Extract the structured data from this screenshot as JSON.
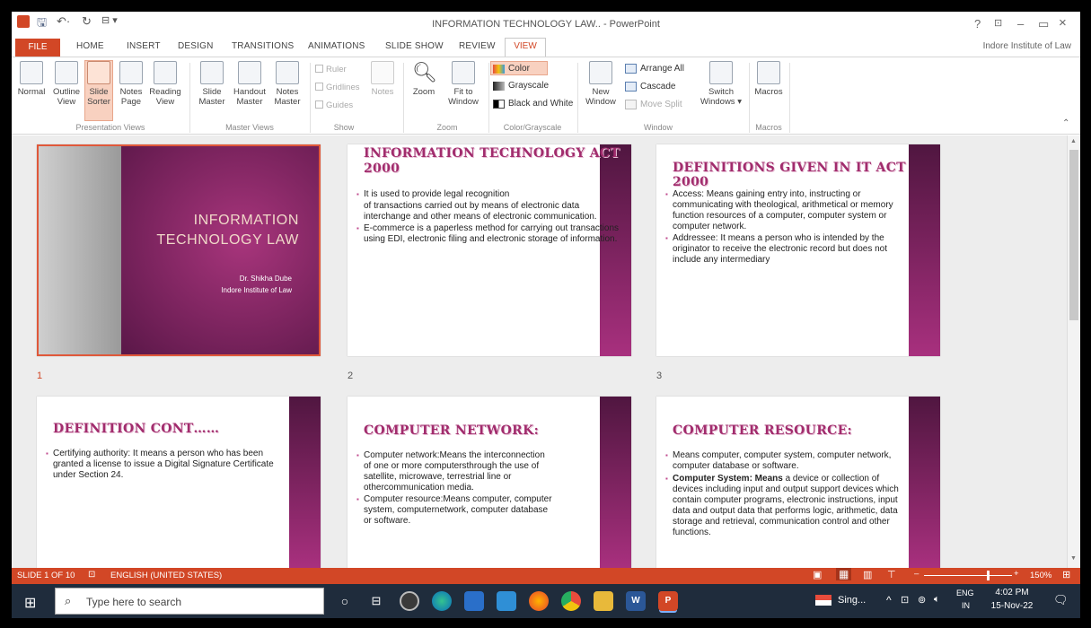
{
  "window": {
    "title": "INFORMATION TECHNOLOGY LAW.. - PowerPoint",
    "account": "Indore Institute of Law",
    "help": "?",
    "minimize": "–",
    "restore": "▭",
    "close": "×"
  },
  "tabs": {
    "file": "FILE",
    "home": "HOME",
    "insert": "INSERT",
    "design": "DESIGN",
    "transitions": "TRANSITIONS",
    "animations": "ANIMATIONS",
    "slideshow": "SLIDE SHOW",
    "review": "REVIEW",
    "view": "VIEW"
  },
  "ribbon": {
    "normal": "Normal",
    "outline": "Outline\nView",
    "slide_sorter": "Slide\nSorter",
    "notes_page": "Notes\nPage",
    "reading_view": "Reading\nView",
    "slide_master": "Slide\nMaster",
    "handout_master": "Handout\nMaster",
    "notes_master": "Notes\nMaster",
    "ruler": "Ruler",
    "gridlines": "Gridlines",
    "guides": "Guides",
    "notes": "Notes",
    "zoom": "Zoom",
    "fit_window": "Fit to\nWindow",
    "color": "Color",
    "grayscale": "Grayscale",
    "bw": "Black and White",
    "new_window": "New\nWindow",
    "arrange_all": "Arrange All",
    "cascade": "Cascade",
    "move_split": "Move Split",
    "switch_windows": "Switch\nWindows ▾",
    "macros": "Macros",
    "groups": {
      "presentation_views": "Presentation Views",
      "master_views": "Master Views",
      "show": "Show",
      "zoom": "Zoom",
      "color": "Color/Grayscale",
      "window": "Window",
      "macros": "Macros"
    }
  },
  "slides": [
    {
      "num": "1",
      "title": "INFORMATION\nTECHNOLOGY LAW",
      "author": "Dr. Shikha Dube",
      "institute": "Indore Institute of Law"
    },
    {
      "num": "2",
      "title": "INFORMATION TECHNOLOGY ACT\n2000",
      "bullets": [
        "It is used to provide legal recognition",
        "of transactions carried out by means of electronic data interchange and other means of electronic communication.",
        "E-commerce is a paperless method for carrying out transactions using EDI, electronic filing and electronic storage of information."
      ]
    },
    {
      "num": "3",
      "title": "DEFINITIONS GIVEN IN IT ACT 2000",
      "bullets": [
        "Access: Means gaining entry into, instructing or communicating with theological, arithmetical or memory function resources of a computer, computer system or computer network.",
        "Addressee: It means a person who is intended by the originator to receive the electronic record but does not include any intermediary"
      ]
    },
    {
      "num": "",
      "title": "DEFINITION CONT……",
      "bullets": [
        "Certifying authority: It means a person who has been granted a license to issue a Digital Signature Certificate under Section 24."
      ]
    },
    {
      "num": "",
      "title": "COMPUTER NETWORK:",
      "bullets": [
        "Computer network:Means the interconnection of one or more computersthrough the use of satellite, microwave, terrestrial line or othercommunication media.",
        "Computer resource:Means computer, computer system, computernetwork, computer database or software."
      ]
    },
    {
      "num": "",
      "title": "COMPUTER RESOURCE:",
      "bullets": [
        "Means computer, computer system, computer network, computer database or software.",
        "Computer System: Means a device or collection of devices including input and output support devices which contain computer programs, electronic instructions, input data and output data that performs logic, arithmetic, data storage and retrieval, communication control and other functions."
      ],
      "bold_lead": "Computer System: Means"
    }
  ],
  "status": {
    "slide_of": "SLIDE 1 OF 10",
    "language": "ENGLISH (UNITED STATES)",
    "zoom": "150%"
  },
  "taskbar": {
    "search_placeholder": "Type here to search",
    "weather": "Sing...",
    "lang1": "ENG",
    "lang2": "IN",
    "time": "4:02 PM",
    "date": "15-Nov-22"
  },
  "colors": {
    "accent": "#d24726",
    "slide_purple": "#8a2570",
    "title_pink": "#a12c6d"
  }
}
